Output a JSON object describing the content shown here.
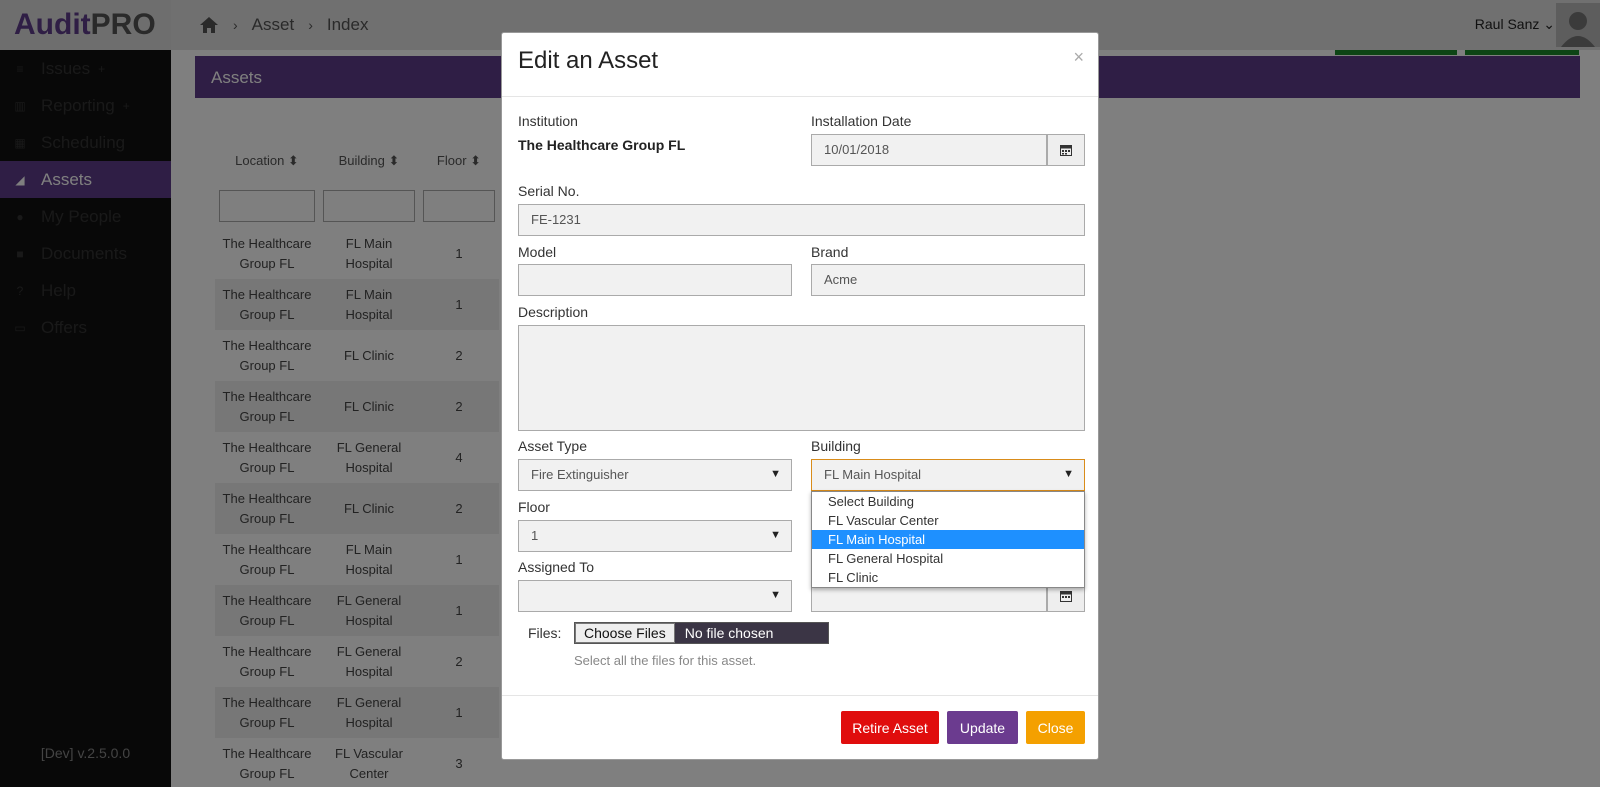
{
  "app": {
    "logo_part1": "Audit",
    "logo_part2": "PRO",
    "version": "[Dev] v.2.5.0.0"
  },
  "breadcrumb": {
    "level1": "Asset",
    "level2": "Index",
    "sep": "›"
  },
  "user": {
    "name": "Raul Sanz",
    "caret": "⌄"
  },
  "sidebar": {
    "items": [
      {
        "label": "Issues",
        "icon": "list-icon",
        "plus": "+"
      },
      {
        "label": "Reporting",
        "icon": "bar-chart-icon",
        "plus": "+"
      },
      {
        "label": "Scheduling",
        "icon": "calendar-icon",
        "plus": ""
      },
      {
        "label": "Assets",
        "icon": "area-chart-icon",
        "plus": ""
      },
      {
        "label": "My People",
        "icon": "users-icon",
        "plus": ""
      },
      {
        "label": "Documents",
        "icon": "folder-icon",
        "plus": ""
      },
      {
        "label": "Help",
        "icon": "question-icon",
        "plus": ""
      },
      {
        "label": "Offers",
        "icon": "money-icon",
        "plus": ""
      }
    ]
  },
  "panel": {
    "title": "Assets"
  },
  "table": {
    "headers": [
      "Location",
      "Building",
      "Floor"
    ],
    "rows": [
      {
        "loc1": "The Healthcare",
        "loc2": "Group FL",
        "b1": "FL Main",
        "b2": "Hospital",
        "floor": "1"
      },
      {
        "loc1": "The Healthcare",
        "loc2": "Group FL",
        "b1": "FL Main",
        "b2": "Hospital",
        "floor": "1"
      },
      {
        "loc1": "The Healthcare",
        "loc2": "Group FL",
        "b1": "FL Clinic",
        "b2": "",
        "floor": "2"
      },
      {
        "loc1": "The Healthcare",
        "loc2": "Group FL",
        "b1": "FL Clinic",
        "b2": "",
        "floor": "2"
      },
      {
        "loc1": "The Healthcare",
        "loc2": "Group FL",
        "b1": "FL General",
        "b2": "Hospital",
        "floor": "4"
      },
      {
        "loc1": "The Healthcare",
        "loc2": "Group FL",
        "b1": "FL Clinic",
        "b2": "",
        "floor": "2"
      },
      {
        "loc1": "The Healthcare",
        "loc2": "Group FL",
        "b1": "FL Main",
        "b2": "Hospital",
        "floor": "1"
      },
      {
        "loc1": "The Healthcare",
        "loc2": "Group FL",
        "b1": "FL General",
        "b2": "Hospital",
        "floor": "1"
      },
      {
        "loc1": "The Healthcare",
        "loc2": "Group FL",
        "b1": "FL General",
        "b2": "Hospital",
        "floor": "2"
      },
      {
        "loc1": "The Healthcare",
        "loc2": "Group FL",
        "b1": "FL General",
        "b2": "Hospital",
        "floor": "1"
      },
      {
        "loc1": "The Healthcare",
        "loc2": "Group FL",
        "b1": "FL Vascular",
        "b2": "Center",
        "floor": "3"
      }
    ]
  },
  "modal": {
    "title": "Edit an Asset",
    "close": "×",
    "institution_label": "Institution",
    "institution_value": "The Healthcare Group FL",
    "installation_label": "Installation Date",
    "installation_value": "10/01/2018",
    "serial_label": "Serial No.",
    "serial_value": "FE-1231",
    "model_label": "Model",
    "model_value": "",
    "brand_label": "Brand",
    "brand_value": "Acme",
    "description_label": "Description",
    "asset_type_label": "Asset Type",
    "asset_type_value": "Fire Extinguisher",
    "building_label": "Building",
    "building_value": "FL Main Hospital",
    "building_options": [
      "Select Building",
      "FL Vascular Center",
      "FL Main Hospital",
      "FL General Hospital",
      "FL Clinic"
    ],
    "floor_label": "Floor",
    "floor_value": "1",
    "assigned_label": "Assigned To",
    "files_label": "Files:",
    "choose_files": "Choose Files",
    "no_file": "No file chosen",
    "files_hint": "Select all the files for this asset.",
    "btn_retire": "Retire Asset",
    "btn_update": "Update",
    "btn_close": "Close"
  },
  "colors": {
    "brand": "#5e3d8a",
    "retire": "#e00d0d",
    "update": "#6b3b8f",
    "close": "#f4a000",
    "select_highlight": "#1e90ff"
  }
}
